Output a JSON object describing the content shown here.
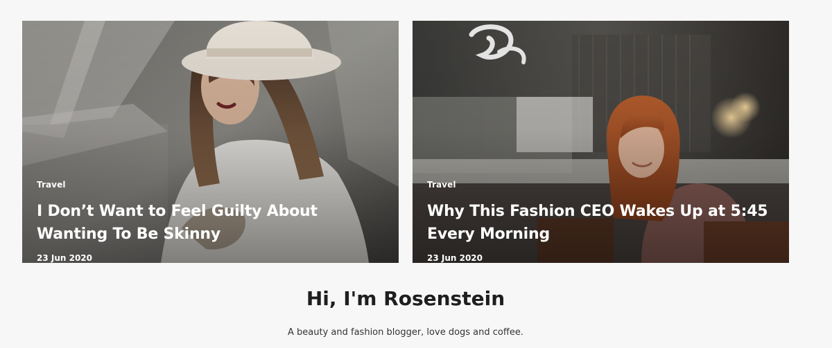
{
  "posts": [
    {
      "category": "Travel",
      "title": "I Don’t Want to Feel Guilty About Wanting To Be Skinny",
      "date": "23 Jun 2020",
      "image": "woman-in-white-hat-photo"
    },
    {
      "category": "Travel",
      "title": "Why This Fashion CEO Wakes Up at 5:45 Every Morning",
      "date": "23 Jun 2020",
      "image": "woman-in-cafe-photo"
    }
  ],
  "author": {
    "heading": "Hi, I'm Rosenstein",
    "bio": "A beauty and fashion blogger, love dogs and coffee."
  },
  "colors": {
    "background": "#f7f7f7",
    "heading": "#1e1e1e",
    "card_text": "#ffffff"
  }
}
